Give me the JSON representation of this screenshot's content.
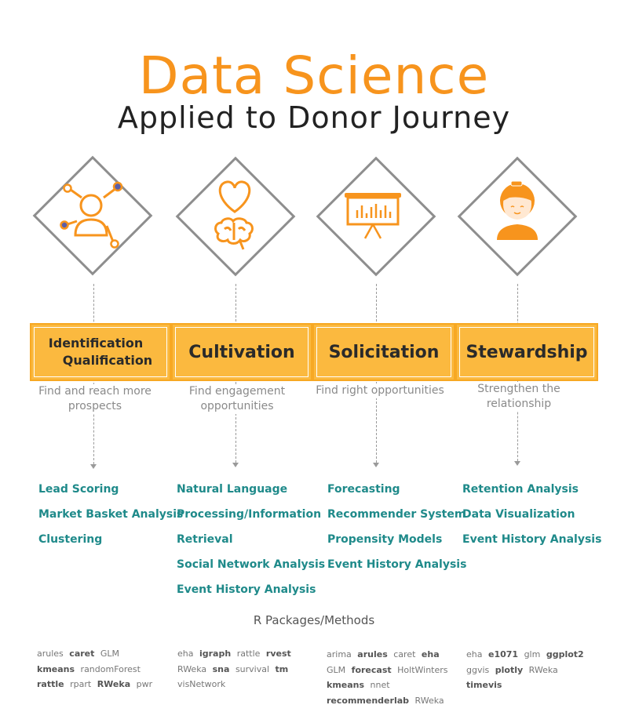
{
  "title": {
    "main": "Data Science",
    "sub": "Applied to Donor Journey"
  },
  "colors": {
    "accent": "#f7941d",
    "stage_fill": "#fbb93f",
    "method_text": "#1f8a8a",
    "diamond_border": "#8e8e8e"
  },
  "stages": [
    {
      "icon": "person-network-icon",
      "label_lines": [
        "Identification",
        "Qualification"
      ],
      "description": "Find and reach more prospects",
      "methods": [
        "Lead Scoring",
        "Market Basket Analysis",
        "Clustering"
      ],
      "packages": [
        {
          "name": "arules",
          "bold": false
        },
        {
          "name": "caret",
          "bold": true
        },
        {
          "name": "GLM",
          "bold": false
        },
        {
          "name": "kmeans",
          "bold": true
        },
        {
          "name": "randomForest",
          "bold": false
        },
        {
          "name": "rattle",
          "bold": true
        },
        {
          "name": "rpart",
          "bold": false
        },
        {
          "name": "RWeka",
          "bold": true
        },
        {
          "name": "pwr",
          "bold": false
        }
      ]
    },
    {
      "icon": "heart-brain-icon",
      "label_lines": [
        "Cultivation"
      ],
      "description": "Find engagement opportunities",
      "methods": [
        "Natural Language",
        "Processing/Information",
        "Retrieval",
        "Social Network Analysis",
        "Event History Analysis"
      ],
      "packages": [
        {
          "name": "eha",
          "bold": false
        },
        {
          "name": "igraph",
          "bold": true
        },
        {
          "name": "rattle",
          "bold": false
        },
        {
          "name": "rvest",
          "bold": true
        },
        {
          "name": "RWeka",
          "bold": false
        },
        {
          "name": "sna",
          "bold": true
        },
        {
          "name": "survival",
          "bold": false
        },
        {
          "name": "tm",
          "bold": true
        },
        {
          "name": "visNetwork",
          "bold": false
        }
      ]
    },
    {
      "icon": "presentation-chart-icon",
      "label_lines": [
        "Solicitation"
      ],
      "description": "Find right opportunities",
      "methods": [
        "Forecasting",
        "Recommender System",
        "Propensity Models",
        "Event History Analysis"
      ],
      "packages": [
        {
          "name": "arima",
          "bold": false
        },
        {
          "name": "arules",
          "bold": true
        },
        {
          "name": "caret",
          "bold": false
        },
        {
          "name": "eha",
          "bold": true
        },
        {
          "name": "GLM",
          "bold": false
        },
        {
          "name": "forecast",
          "bold": true
        },
        {
          "name": "HoltWinters",
          "bold": false
        },
        {
          "name": "kmeans",
          "bold": true
        },
        {
          "name": "nnet",
          "bold": false
        },
        {
          "name": "recommenderlab",
          "bold": true
        },
        {
          "name": "RWeka",
          "bold": false
        }
      ]
    },
    {
      "icon": "donor-woman-icon",
      "label_lines": [
        "Stewardship"
      ],
      "description": "Strengthen the relationship",
      "methods": [
        "Retention Analysis",
        "Data Visualization",
        "Event History Analysis"
      ],
      "packages": [
        {
          "name": "eha",
          "bold": false
        },
        {
          "name": "e1071",
          "bold": true
        },
        {
          "name": "glm",
          "bold": false
        },
        {
          "name": "ggplot2",
          "bold": true
        },
        {
          "name": "ggvis",
          "bold": false
        },
        {
          "name": "plotly",
          "bold": true
        },
        {
          "name": "RWeka",
          "bold": false
        },
        {
          "name": "timevis",
          "bold": true
        }
      ]
    }
  ],
  "packages_heading": "R Packages/Methods"
}
